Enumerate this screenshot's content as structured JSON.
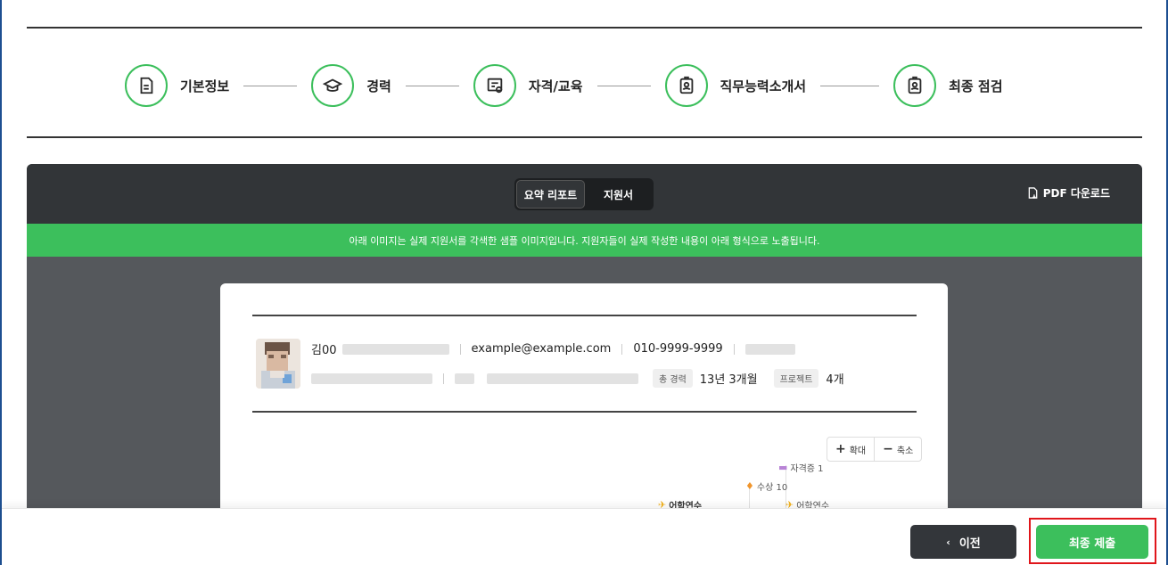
{
  "steps": [
    {
      "label": "기본정보",
      "icon": "document-icon"
    },
    {
      "label": "경력",
      "icon": "graduation-cap-icon"
    },
    {
      "label": "자격/교육",
      "icon": "certificate-icon"
    },
    {
      "label": "직무능력소개서",
      "icon": "id-badge-icon"
    },
    {
      "label": "최종 점검",
      "icon": "id-badge-icon"
    }
  ],
  "preview": {
    "tabs": [
      {
        "label": "요약 리포트",
        "active": true
      },
      {
        "label": "지원서",
        "active": false
      }
    ],
    "pdf_label": "PDF 다운로드",
    "notice": "아래 이미지는 실제 지원서를 각색한 샘플 이미지입니다. 지원자들이 실제 작성한 내용이 아래 형식으로 노출됩니다."
  },
  "profile": {
    "name": "김00",
    "email": "example@example.com",
    "phone": "010-9999-9999",
    "career_tag": "총 경력",
    "career_value": "13년 3개월",
    "project_tag": "프로젝트",
    "project_value": "4개"
  },
  "zoom": {
    "in_label": "확대",
    "out_label": "축소"
  },
  "timeline": {
    "cert": "자격증 1",
    "award": "수상 10",
    "lang1": "어학연수",
    "lang2": "어학연수"
  },
  "footer": {
    "prev_label": "이전",
    "submit_label": "최종 제출"
  },
  "colors": {
    "accent": "#3cbf5c",
    "dark": "#33363a",
    "highlight": "#e0161b"
  }
}
